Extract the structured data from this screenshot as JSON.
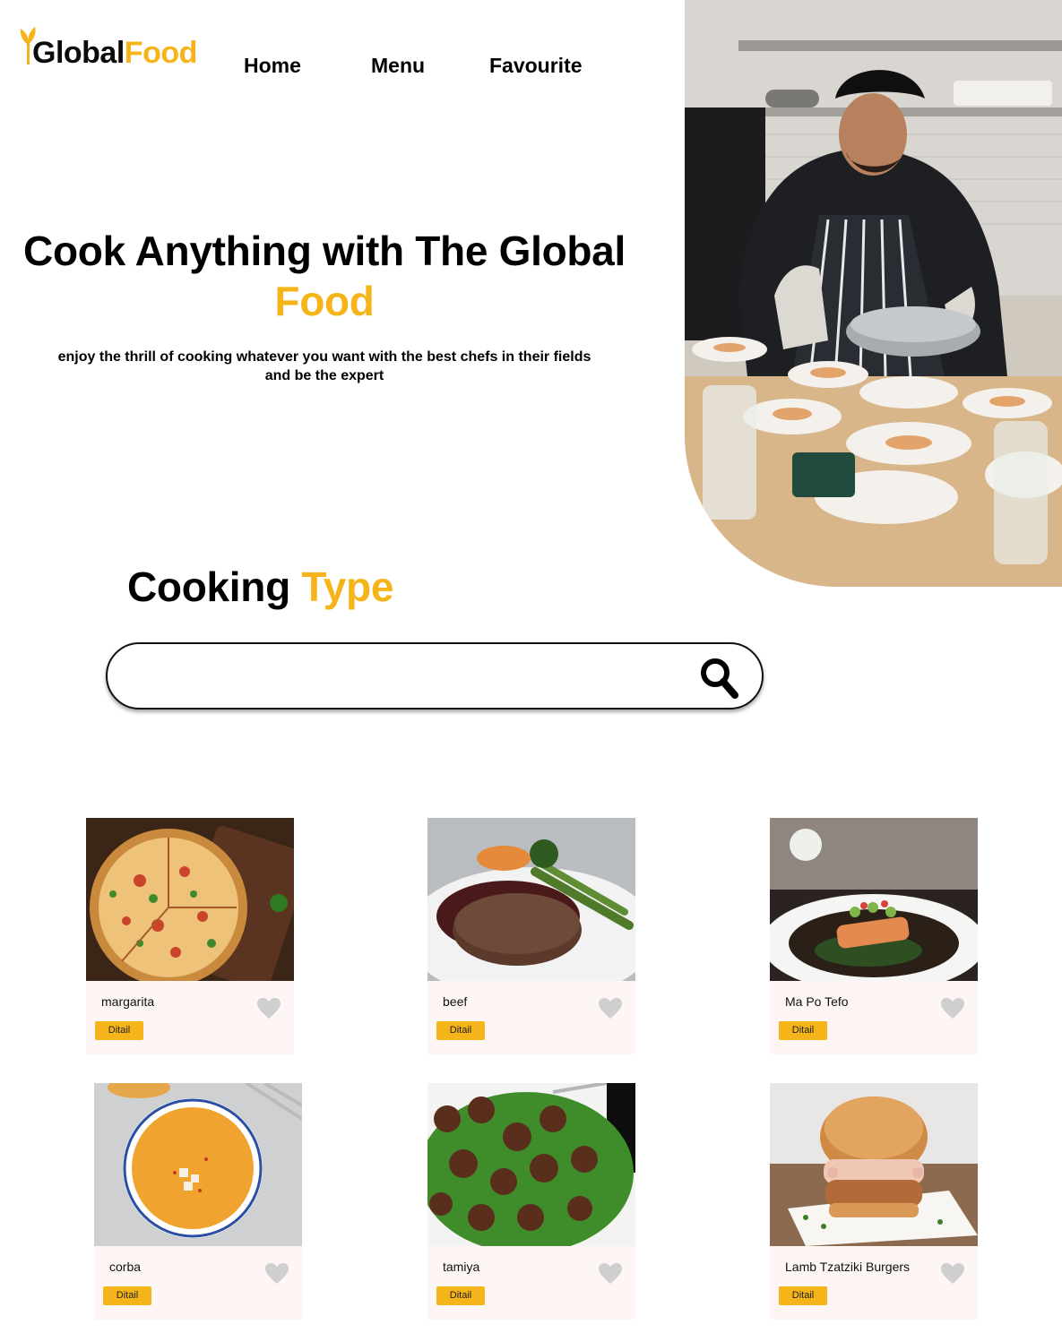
{
  "brand": {
    "part1": "Global",
    "part2": "Food"
  },
  "nav": {
    "home": "Home",
    "menu": "Menu",
    "favourite": "Favourite"
  },
  "hero": {
    "title_line1": "Cook Anything with The Global",
    "title_line2": "Food",
    "subtitle_line1": "enjoy the thrill of cooking whatever you want with the best chefs in their fields",
    "subtitle_line2": "and be the expert",
    "image": "chef-plating-dishes-photo"
  },
  "section": {
    "title_part1": "Cooking",
    "title_part2": "Type"
  },
  "search": {
    "value": "",
    "placeholder": "",
    "icon": "search-icon"
  },
  "cards": [
    {
      "name": "margarita",
      "button": "Ditail",
      "image": "pizza-photo",
      "favourite": false
    },
    {
      "name": "beef",
      "button": "Ditail",
      "image": "steak-photo",
      "favourite": false
    },
    {
      "name": "Ma Po Tefo",
      "button": "Ditail",
      "image": "salmon-plate-photo",
      "favourite": false
    },
    {
      "name": "corba",
      "button": "Ditail",
      "image": "soup-photo",
      "favourite": false
    },
    {
      "name": "tamiya",
      "button": "Ditail",
      "image": "meatballs-photo",
      "favourite": false
    },
    {
      "name": "Lamb Tzatziki Burgers",
      "button": "Ditail",
      "image": "burger-photo",
      "favourite": false
    }
  ],
  "colors": {
    "accent": "#F5B419",
    "card_bg": "#FDF6F5",
    "heart": "#CFCFCF",
    "text": "#000000"
  }
}
